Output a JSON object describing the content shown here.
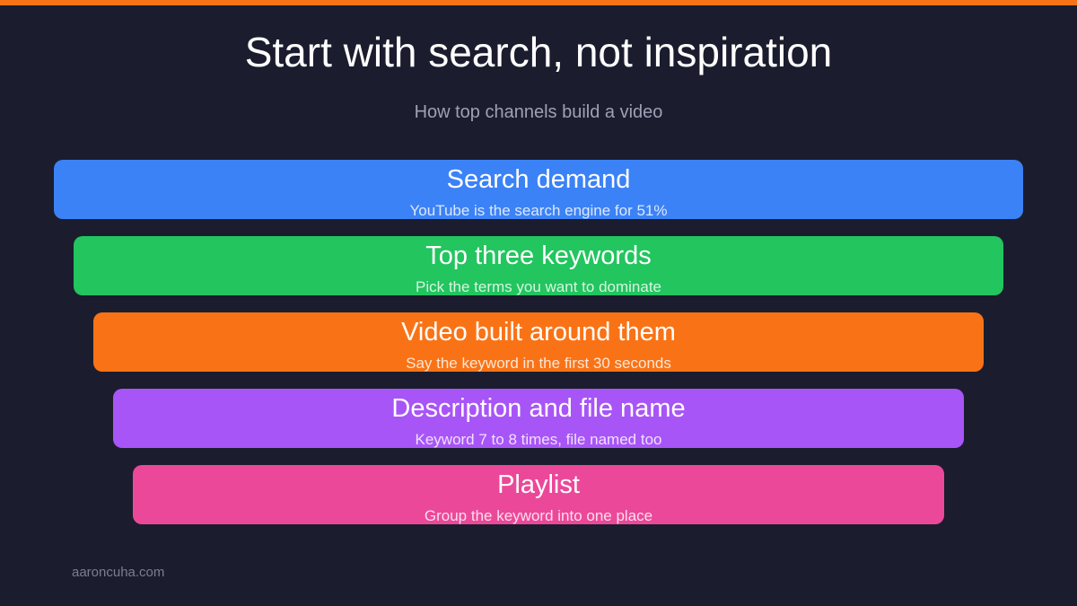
{
  "header": {
    "title": "Start with search, not inspiration",
    "subtitle": "How top channels build a video"
  },
  "funnel": {
    "steps": [
      {
        "label": "Search demand",
        "description": "YouTube is the search engine for 51%",
        "color": "#3b82f6"
      },
      {
        "label": "Top three keywords",
        "description": "Pick the terms you want to dominate",
        "color": "#22c55e"
      },
      {
        "label": "Video built around them",
        "description": "Say the keyword in the first 30 seconds",
        "color": "#f97316"
      },
      {
        "label": "Description and file name",
        "description": "Keyword 7 to 8 times, file named too",
        "color": "#a855f7"
      },
      {
        "label": "Playlist",
        "description": "Group the keyword into one place",
        "color": "#ec4899"
      }
    ]
  },
  "footer": {
    "site": "aaroncuha.com"
  },
  "theme": {
    "background": "#1b1d2e",
    "accent": "#f97316"
  }
}
